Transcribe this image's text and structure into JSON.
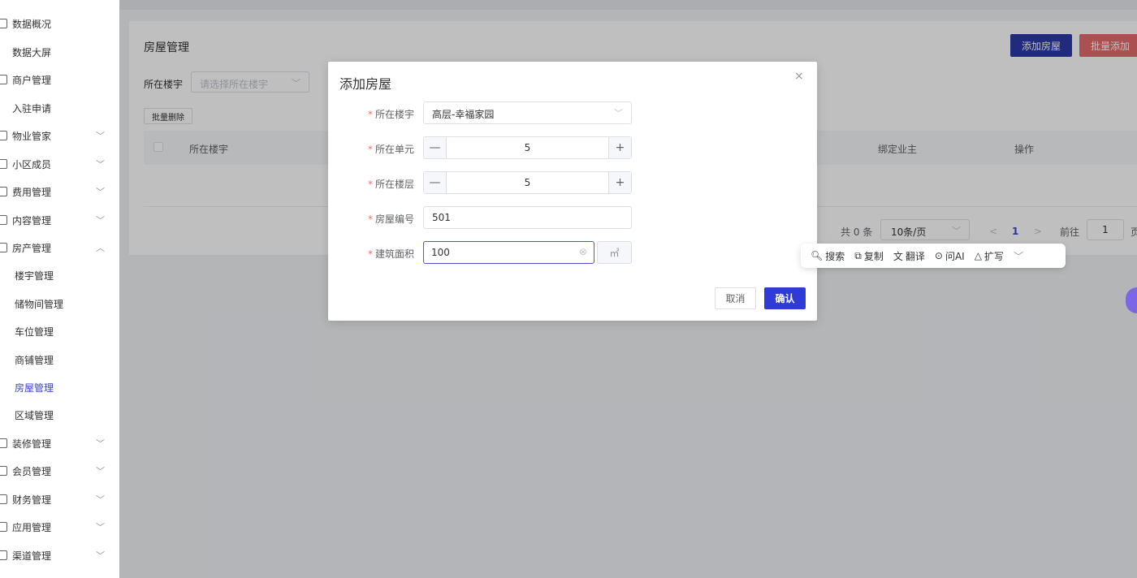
{
  "sidebar": {
    "items": [
      {
        "label": "数据概况",
        "icon": "chart-icon",
        "chevron": ""
      },
      {
        "label": "数据大屏",
        "icon": "",
        "chevron": ""
      },
      {
        "label": "商户管理",
        "icon": "shop-icon",
        "chevron": ""
      },
      {
        "label": "入驻申请",
        "icon": "",
        "chevron": ""
      },
      {
        "label": "物业管家",
        "icon": "butler-icon",
        "chevron": "﹀"
      },
      {
        "label": "小区成员",
        "icon": "people-icon",
        "chevron": "﹀"
      },
      {
        "label": "费用管理",
        "icon": "fee-icon",
        "chevron": "﹀"
      },
      {
        "label": "内容管理",
        "icon": "content-icon",
        "chevron": "﹀"
      },
      {
        "label": "房产管理",
        "icon": "estate-icon",
        "chevron": "︿"
      },
      {
        "label": "楼宇管理",
        "icon": "",
        "chevron": ""
      },
      {
        "label": "储物间管理",
        "icon": "",
        "chevron": ""
      },
      {
        "label": "车位管理",
        "icon": "",
        "chevron": ""
      },
      {
        "label": "商铺管理",
        "icon": "",
        "chevron": ""
      },
      {
        "label": "房屋管理",
        "icon": "",
        "chevron": ""
      },
      {
        "label": "区域管理",
        "icon": "",
        "chevron": ""
      },
      {
        "label": "装修管理",
        "icon": "renovation-icon",
        "chevron": "﹀"
      },
      {
        "label": "会员管理",
        "icon": "member-icon",
        "chevron": "﹀"
      },
      {
        "label": "财务管理",
        "icon": "finance-icon",
        "chevron": "﹀"
      },
      {
        "label": "应用管理",
        "icon": "app-icon",
        "chevron": "﹀"
      },
      {
        "label": "渠道管理",
        "icon": "channel-icon",
        "chevron": "﹀"
      }
    ],
    "active_index": 13
  },
  "page": {
    "title": "房屋管理",
    "add_button": "添加房屋",
    "batch_add_button": "批量添加",
    "filter_label": "所在楼宇",
    "filter_placeholder": "请选择所在楼宇",
    "batch_delete_button": "批量删除",
    "columns": {
      "building": "所在楼宇",
      "owner": "绑定业主",
      "actions": "操作"
    },
    "pagination": {
      "total": "共 0 条",
      "page_size": "10条/页",
      "prev": "<",
      "current": "1",
      "next": ">",
      "goto_label": "前往",
      "goto_value": "1",
      "goto_suffix": "页"
    }
  },
  "dialog": {
    "title": "添加房屋",
    "close": "×",
    "fields": {
      "building": {
        "label": "所在楼宇",
        "value": "高层-幸福家园"
      },
      "unit": {
        "label": "所在单元",
        "value": "5",
        "minus": "—",
        "plus": "+"
      },
      "floor": {
        "label": "所在楼层",
        "value": "5",
        "minus": "—",
        "plus": "+"
      },
      "room_no": {
        "label": "房屋编号",
        "value": "501"
      },
      "area": {
        "label": "建筑面积",
        "value": "100",
        "unit": "㎡"
      }
    },
    "required_mark": "*",
    "cancel": "取消",
    "confirm": "确认"
  },
  "float_toolbar": {
    "search": "搜索",
    "copy": "复制",
    "translate": "翻译",
    "ask_ai": "问AI",
    "expand": "扩写",
    "more": "﹀"
  },
  "colors": {
    "primary": "#2f3bd6",
    "danger": "#e46b6b",
    "required": "#f56c6c"
  }
}
